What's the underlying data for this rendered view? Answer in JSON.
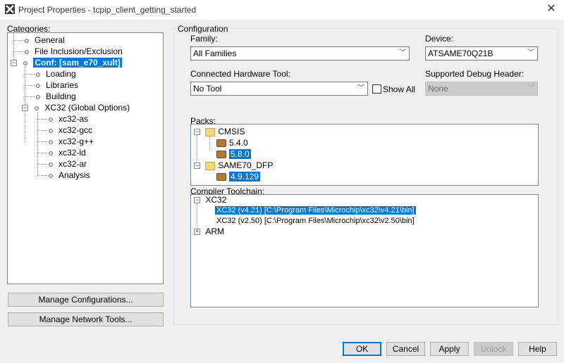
{
  "window": {
    "title": "Project Properties - tcpip_client_getting_started",
    "close_glyph": "✕"
  },
  "categories": {
    "label": "Categories:",
    "items": [
      {
        "label": "General"
      },
      {
        "label": "File Inclusion/Exclusion"
      },
      {
        "label": "Conf: [sam_e70_xult]",
        "selected": true
      },
      {
        "label": "Loading"
      },
      {
        "label": "Libraries"
      },
      {
        "label": "Building"
      },
      {
        "label": "XC32 (Global Options)"
      },
      {
        "label": "xc32-as"
      },
      {
        "label": "xc32-gcc"
      },
      {
        "label": "xc32-g++"
      },
      {
        "label": "xc32-ld"
      },
      {
        "label": "xc32-ar"
      },
      {
        "label": "Analysis"
      }
    ],
    "expander_collapse": "−"
  },
  "left_buttons": {
    "manage_configurations": "Manage Configurations...",
    "manage_network_tools": "Manage Network Tools..."
  },
  "configuration": {
    "title": "Configuration",
    "family_label": "Family:",
    "family_value": "All Families",
    "device_label": "Device:",
    "device_value": "ATSAME70Q21B",
    "hw_tool_label": "Connected Hardware Tool:",
    "hw_tool_value": "No Tool",
    "show_all_label": "Show All",
    "debug_header_label": "Supported Debug Header:",
    "debug_header_value": "None",
    "packs_label": "Packs:",
    "packs": [
      {
        "name": "CMSIS",
        "versions": [
          "5.4.0",
          "5.8.0"
        ],
        "selected": "5.8.0"
      },
      {
        "name": "SAME70_DFP",
        "versions": [
          "4.9.129"
        ],
        "selected": "4.9.129"
      }
    ],
    "toolchain_label": "Compiler Toolchain:",
    "toolchains": {
      "group1": "XC32",
      "items": [
        "XC32 (v4.21) [C:\\Program Files\\Microchip\\xc32\\v4.21\\bin]",
        "XC32 (v2.50) [C:\\Program Files\\Microchip\\xc32\\v2.50\\bin]"
      ],
      "selected_index": 0,
      "group2": "ARM"
    },
    "expand_glyph": "+"
  },
  "dialog_buttons": {
    "ok": "OK",
    "cancel": "Cancel",
    "apply": "Apply",
    "unlock": "Unlock",
    "help": "Help"
  },
  "colors": {
    "selection": "#0078d7",
    "title_bar": "#ffffff"
  }
}
